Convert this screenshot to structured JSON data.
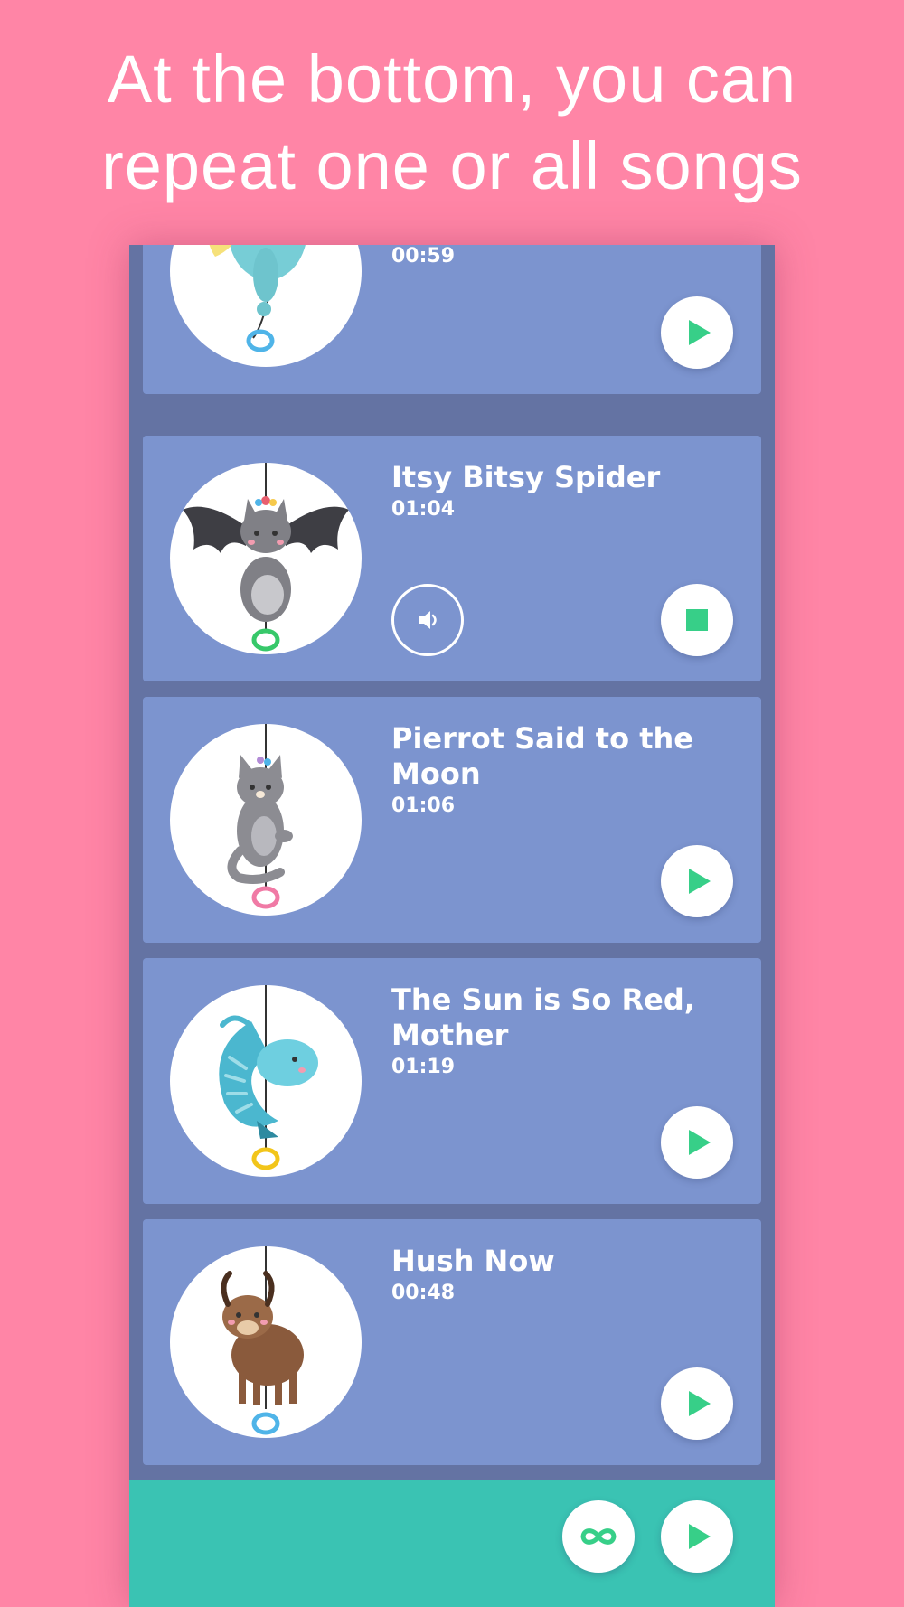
{
  "headline": {
    "line1": "At the bottom, you can",
    "line2": "repeat one or all songs"
  },
  "colors": {
    "background": "#ff85a6",
    "card": "#7c94cf",
    "list_background": "#6473a3",
    "bottom_bar": "#3ac3b3",
    "accent_green": "#37cf88"
  },
  "songs": [
    {
      "title": "",
      "duration": "00:59",
      "animal": "unicorn",
      "state": "stopped",
      "action_icon": "play-icon"
    },
    {
      "title": "Itsy Bitsy Spider",
      "duration": "01:04",
      "animal": "bat-cat",
      "state": "playing",
      "action_icon": "stop-icon",
      "secondary_icon": "volume-icon"
    },
    {
      "title": "Pierrot Said to the Moon",
      "duration": "01:06",
      "animal": "cat",
      "state": "stopped",
      "action_icon": "play-icon"
    },
    {
      "title": "The Sun is So Red, Mother",
      "duration": "01:19",
      "animal": "chameleon",
      "state": "stopped",
      "action_icon": "play-icon"
    },
    {
      "title": "Hush Now",
      "duration": "00:48",
      "animal": "yak",
      "state": "stopped",
      "action_icon": "play-icon"
    }
  ],
  "bottom_bar": {
    "repeat_icon": "infinity-icon",
    "play_all_icon": "play-icon"
  }
}
